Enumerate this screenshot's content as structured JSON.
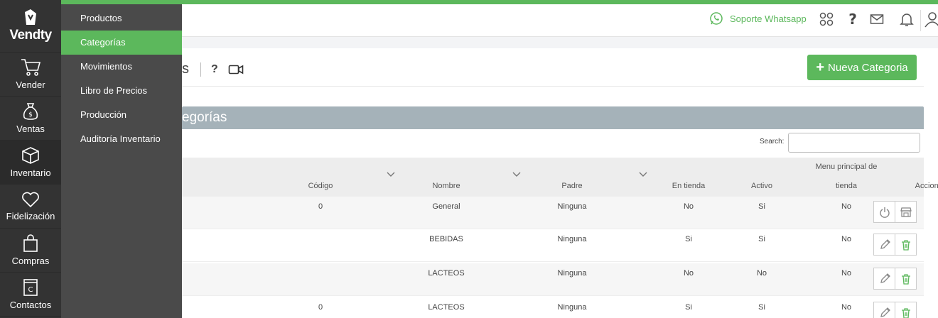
{
  "brand": {
    "name": "Vendty"
  },
  "sidebar": {
    "items": [
      {
        "label": "Vender",
        "icon": "cart-icon"
      },
      {
        "label": "Ventas",
        "icon": "money-bag-icon"
      },
      {
        "label": "Inventario",
        "icon": "box-icon"
      },
      {
        "label": "Fidelización",
        "icon": "heart-icon"
      },
      {
        "label": "Compras",
        "icon": "shopping-bag-icon"
      },
      {
        "label": "Contactos",
        "icon": "contacts-icon"
      }
    ]
  },
  "submenu": {
    "items": [
      {
        "label": "Productos"
      },
      {
        "label": "Categorías"
      },
      {
        "label": "Movimientos"
      },
      {
        "label": "Libro de Precios"
      },
      {
        "label": "Producción"
      },
      {
        "label": "Auditoría Inventario"
      }
    ]
  },
  "topbar": {
    "support_label": "Soporte Whatsapp"
  },
  "page": {
    "title_fragment": "s",
    "help": "?",
    "new_button": "Nueva Categoria",
    "panel_title": "egorías"
  },
  "search": {
    "label": "Search:"
  },
  "table": {
    "headers": {
      "codigo": "Código",
      "nombre": "Nombre",
      "padre": "Padre",
      "en_tienda": "En tienda",
      "activo": "Activo",
      "menu_l1": "Menu principal de",
      "menu_l2": "tienda",
      "acciones": "Acciones"
    },
    "rows": [
      {
        "codigo": "0",
        "nombre": "General",
        "padre": "Ninguna",
        "en_tienda": "No",
        "activo": "Si",
        "menu": "No"
      },
      {
        "codigo": "",
        "nombre": "BEBIDAS",
        "padre": "Ninguna",
        "en_tienda": "Si",
        "activo": "Si",
        "menu": "No"
      },
      {
        "codigo": "",
        "nombre": "LACTEOS",
        "padre": "Ninguna",
        "en_tienda": "No",
        "activo": "No",
        "menu": "No"
      },
      {
        "codigo": "0",
        "nombre": "LACTEOS",
        "padre": "Ninguna",
        "en_tienda": "Si",
        "activo": "Si",
        "menu": "No"
      }
    ]
  },
  "colors": {
    "accent": "#5cb85c",
    "sidebar": "#333333",
    "flyout": "#4a4a4a",
    "panel": "#a5b2b9"
  }
}
